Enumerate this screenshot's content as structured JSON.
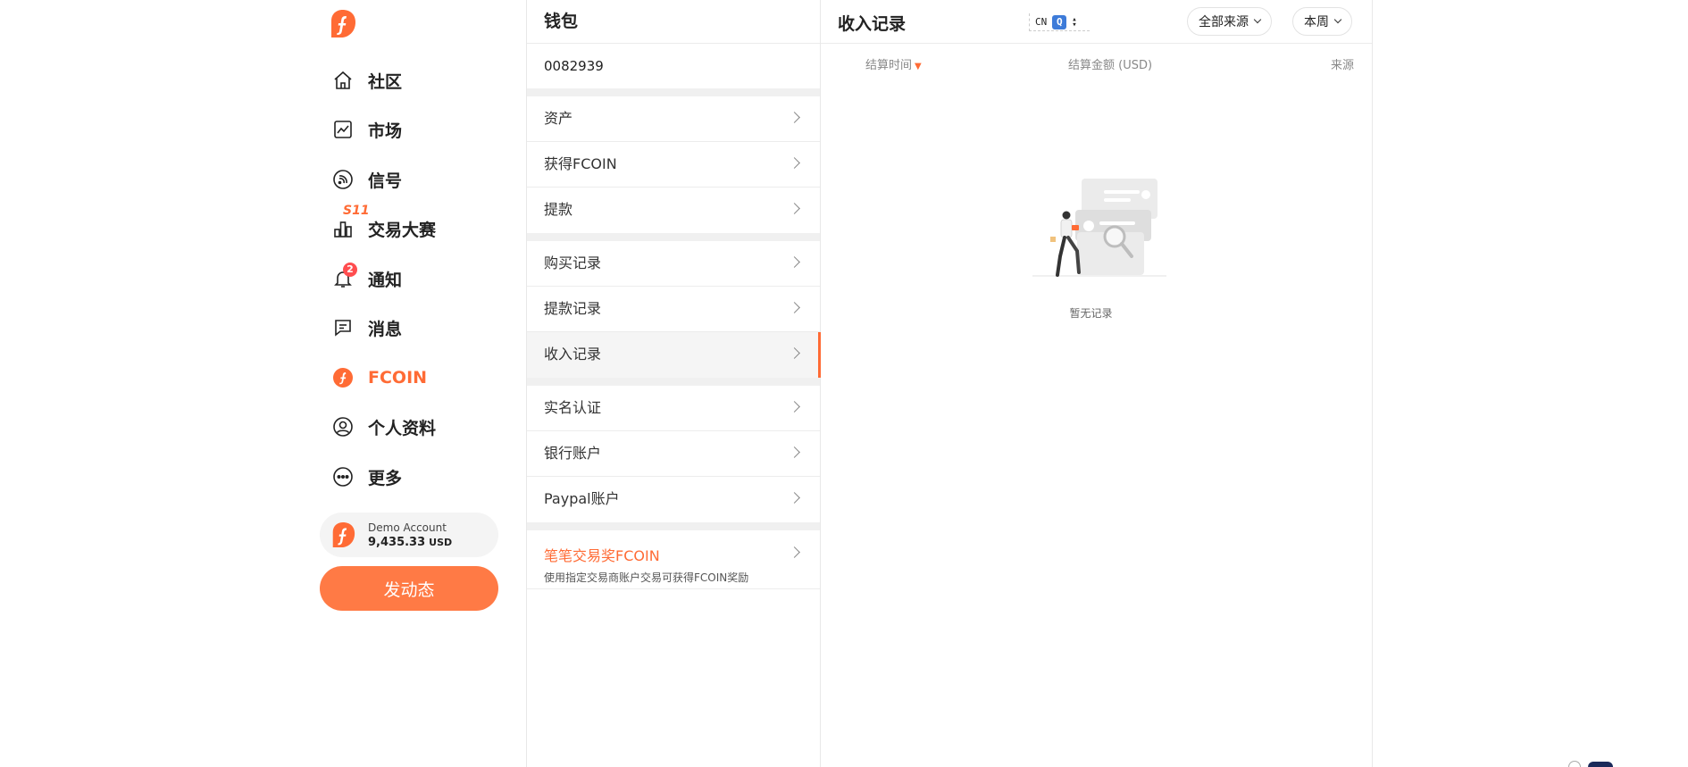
{
  "nav": {
    "items": [
      {
        "label": "社区",
        "icon": "home-icon"
      },
      {
        "label": "市场",
        "icon": "chart-line-icon"
      },
      {
        "label": "信号",
        "icon": "signal-icon"
      },
      {
        "label": "交易大赛",
        "icon": "bar-chart-icon",
        "tag": "S11"
      },
      {
        "label": "通知",
        "icon": "bell-icon",
        "badge": "2"
      },
      {
        "label": "消息",
        "icon": "message-icon"
      },
      {
        "label": "FCOIN",
        "icon": "fcoin-icon",
        "active": true
      },
      {
        "label": "个人资料",
        "icon": "user-icon"
      },
      {
        "label": "更多",
        "icon": "more-icon"
      }
    ],
    "account": {
      "name": "Demo Account",
      "balance": "9,435.33",
      "currency": "USD"
    },
    "post_button": "发动态",
    "brand_color": "#ff6b35"
  },
  "wallet": {
    "title": "钱包",
    "id": "0082939",
    "groups": [
      [
        "资产",
        "获得FCOIN",
        "提款"
      ],
      [
        "购买记录",
        "提款记录",
        "收入记录"
      ],
      [
        "实名认证",
        "银行账户",
        "Paypal账户"
      ]
    ],
    "selected": "收入记录",
    "promo": {
      "title": "笔笔交易奖FCOIN",
      "subtitle": "使用指定交易商账户交易可获得FCOIN奖励"
    }
  },
  "income": {
    "title": "收入记录",
    "cn_widget": {
      "text": "CN",
      "q": "Q"
    },
    "source_filter": "全部来源",
    "period_filter": "本周",
    "columns": {
      "time": "结算时间",
      "amount": "结算金额 (USD)",
      "source": "来源"
    },
    "empty_text": "暂无记录"
  }
}
